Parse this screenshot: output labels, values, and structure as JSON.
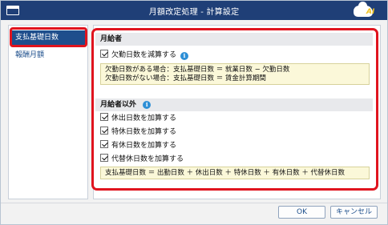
{
  "window": {
    "title": "月額改定処理 - 計算設定",
    "logo_text": "AI"
  },
  "sidebar": {
    "items": [
      {
        "label": "支払基礎日数",
        "active": true
      },
      {
        "label": "報酬月額",
        "active": false
      }
    ]
  },
  "monthly": {
    "heading": "月給者",
    "deduct_absence": {
      "label": "欠勤日数を減算する",
      "checked": true
    },
    "note_lines": [
      "欠勤日数がある場合：支払基礎日数 ＝ 就業日数 − 欠勤日数",
      "欠勤日数がない場合：支払基礎日数 ＝ 賃金計算期間"
    ]
  },
  "non_monthly": {
    "heading": "月給者以外",
    "options": [
      {
        "label": "休出日数を加算する",
        "checked": true
      },
      {
        "label": "特休日数を加算する",
        "checked": true
      },
      {
        "label": "有休日数を加算する",
        "checked": true
      },
      {
        "label": "代替休日数を加算する",
        "checked": true
      }
    ],
    "formula": "支払基礎日数 ＝ 出勤日数 ＋ 休出日数 ＋ 特休日数 ＋ 有休日数 ＋ 代替休日数"
  },
  "footer": {
    "ok_label": "OK",
    "cancel_label": "キャンセル"
  },
  "colors": {
    "titlebar": "#1f3f77",
    "highlight": "#e0141e",
    "accent": "#1f4e8c",
    "info": "#2d8fd6",
    "note_bg": "#fbf8d9"
  },
  "icons": {
    "app": "window-icon",
    "logo": "cloud-ai-logo",
    "info": "info-icon",
    "check": "checkbox-checked-icon"
  }
}
